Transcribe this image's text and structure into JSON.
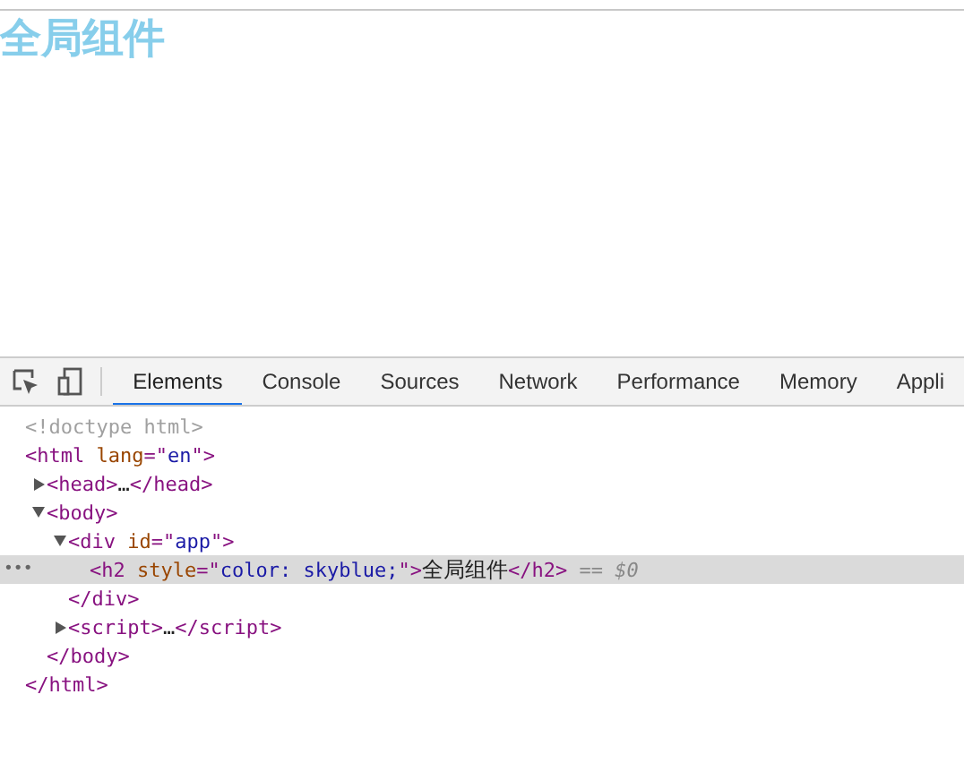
{
  "page": {
    "heading": "全局组件"
  },
  "devtools": {
    "tabs": [
      {
        "label": "Elements",
        "selected": true
      },
      {
        "label": "Console",
        "selected": false
      },
      {
        "label": "Sources",
        "selected": false
      },
      {
        "label": "Network",
        "selected": false
      },
      {
        "label": "Performance",
        "selected": false
      },
      {
        "label": "Memory",
        "selected": false
      },
      {
        "label": "Appli",
        "selected": false
      }
    ],
    "tree": [
      {
        "selected": false,
        "tokens": [
          {
            "kind": "doctype",
            "text": "<!doctype html>"
          }
        ]
      },
      {
        "selected": false,
        "tokens": [
          {
            "kind": "tag",
            "text": "<html"
          },
          {
            "kind": "attr",
            "text": " lang"
          },
          {
            "kind": "tag",
            "text": "=\""
          },
          {
            "kind": "value",
            "text": "en"
          },
          {
            "kind": "tag",
            "text": "\">"
          }
        ],
        "closing": [
          {
            "kind": "tag",
            "text": "</html>"
          }
        ],
        "children": [
          {
            "expanded": false,
            "selected": false,
            "tokens": [
              {
                "kind": "tag",
                "text": "<head>"
              },
              {
                "kind": "text",
                "text": "…"
              },
              {
                "kind": "tag",
                "text": "</head>"
              }
            ]
          },
          {
            "expanded": true,
            "selected": false,
            "tokens": [
              {
                "kind": "tag",
                "text": "<body>"
              }
            ],
            "closing": [
              {
                "kind": "tag",
                "text": "</body>"
              }
            ],
            "children": [
              {
                "expanded": true,
                "selected": false,
                "tokens": [
                  {
                    "kind": "tag",
                    "text": "<div"
                  },
                  {
                    "kind": "attr",
                    "text": " id"
                  },
                  {
                    "kind": "tag",
                    "text": "=\""
                  },
                  {
                    "kind": "value",
                    "text": "app"
                  },
                  {
                    "kind": "tag",
                    "text": "\">"
                  }
                ],
                "closing": [
                  {
                    "kind": "tag",
                    "text": "</div>"
                  }
                ],
                "children": [
                  {
                    "selected": true,
                    "marker": "•••",
                    "tokens": [
                      {
                        "kind": "tag",
                        "text": "<h2"
                      },
                      {
                        "kind": "attr",
                        "text": " style"
                      },
                      {
                        "kind": "tag",
                        "text": "=\""
                      },
                      {
                        "kind": "value",
                        "text": "color: skyblue;"
                      },
                      {
                        "kind": "tag",
                        "text": "\">"
                      },
                      {
                        "kind": "text",
                        "text": "全局组件"
                      },
                      {
                        "kind": "tag",
                        "text": "</h2>"
                      },
                      {
                        "kind": "ref",
                        "text": " == $0"
                      }
                    ]
                  }
                ]
              },
              {
                "expanded": false,
                "selected": false,
                "tokens": [
                  {
                    "kind": "tag",
                    "text": "<script>"
                  },
                  {
                    "kind": "text",
                    "text": "…"
                  },
                  {
                    "kind": "tag",
                    "text": "</script>"
                  }
                ]
              }
            ]
          }
        ]
      }
    ]
  }
}
